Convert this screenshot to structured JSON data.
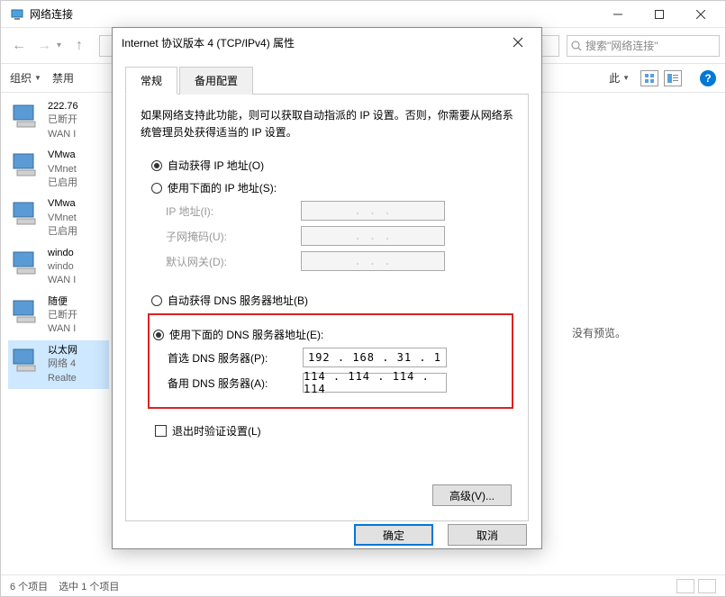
{
  "main": {
    "title": "网络连接",
    "search_placeholder": "搜索\"网络连接\"",
    "toolbar": {
      "organize": "组织",
      "disable": "禁用",
      "more_hidden": "此"
    },
    "preview_empty": "没有预览。",
    "status": {
      "items": "6 个项目",
      "selected": "选中 1 个项目"
    }
  },
  "connections": [
    {
      "name": "222.76",
      "status": "已断开",
      "device": "WAN I"
    },
    {
      "name": "VMwa",
      "status": "VMnet",
      "device": "已启用"
    },
    {
      "name": "VMwa",
      "status": "VMnet",
      "device": "已启用"
    },
    {
      "name": "windo",
      "status": "windo",
      "device": "WAN I"
    },
    {
      "name": "随便",
      "status": "已断开",
      "device": "WAN I"
    },
    {
      "name": "以太网",
      "status": "网络 4",
      "device": "Realte"
    }
  ],
  "dialog": {
    "title": "Internet 协议版本 4 (TCP/IPv4) 属性",
    "tabs": {
      "general": "常规",
      "alt": "备用配置"
    },
    "desc": "如果网络支持此功能，则可以获取自动指派的 IP 设置。否则，你需要从网络系统管理员处获得适当的 IP 设置。",
    "ip": {
      "auto": "自动获得 IP 地址(O)",
      "manual": "使用下面的 IP 地址(S):",
      "addr_label": "IP 地址(I):",
      "mask_label": "子网掩码(U):",
      "gw_label": "默认网关(D):",
      "addr": ".   .   .",
      "mask": ".   .   .",
      "gw": ".   .   ."
    },
    "dns": {
      "auto": "自动获得 DNS 服务器地址(B)",
      "manual": "使用下面的 DNS 服务器地址(E):",
      "pref_label": "首选 DNS 服务器(P):",
      "alt_label": "备用 DNS 服务器(A):",
      "pref": "192 . 168 .  31 .   1",
      "alt": "114 . 114 . 114 . 114"
    },
    "validate": "退出时验证设置(L)",
    "advanced": "高级(V)...",
    "ok": "确定",
    "cancel": "取消"
  }
}
